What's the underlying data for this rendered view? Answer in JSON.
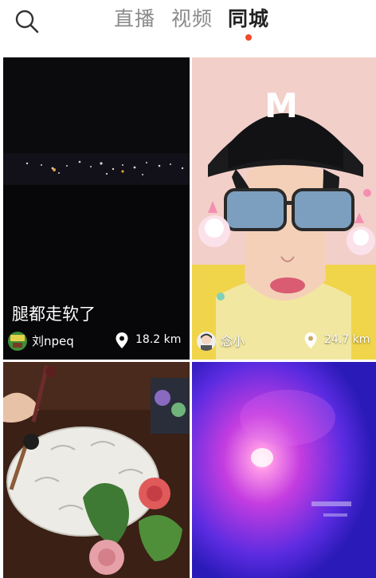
{
  "header": {
    "search_icon": "search-icon",
    "tabs": [
      {
        "label": "直播",
        "active": false
      },
      {
        "label": "视频",
        "active": false
      },
      {
        "label": "同城",
        "active": true
      }
    ],
    "active_indicator_color": "#f24a2a"
  },
  "feed": {
    "cards": [
      {
        "title": "腿都走软了",
        "username": "刘npeq",
        "distance": "18.2 km",
        "location_icon": "location-pin-icon"
      },
      {
        "title": "",
        "username": "念小",
        "distance": "24.7 km",
        "location_icon": "location-pin-icon"
      },
      {
        "title": "",
        "username": "",
        "distance": ""
      },
      {
        "title": "",
        "username": "",
        "distance": ""
      }
    ]
  }
}
